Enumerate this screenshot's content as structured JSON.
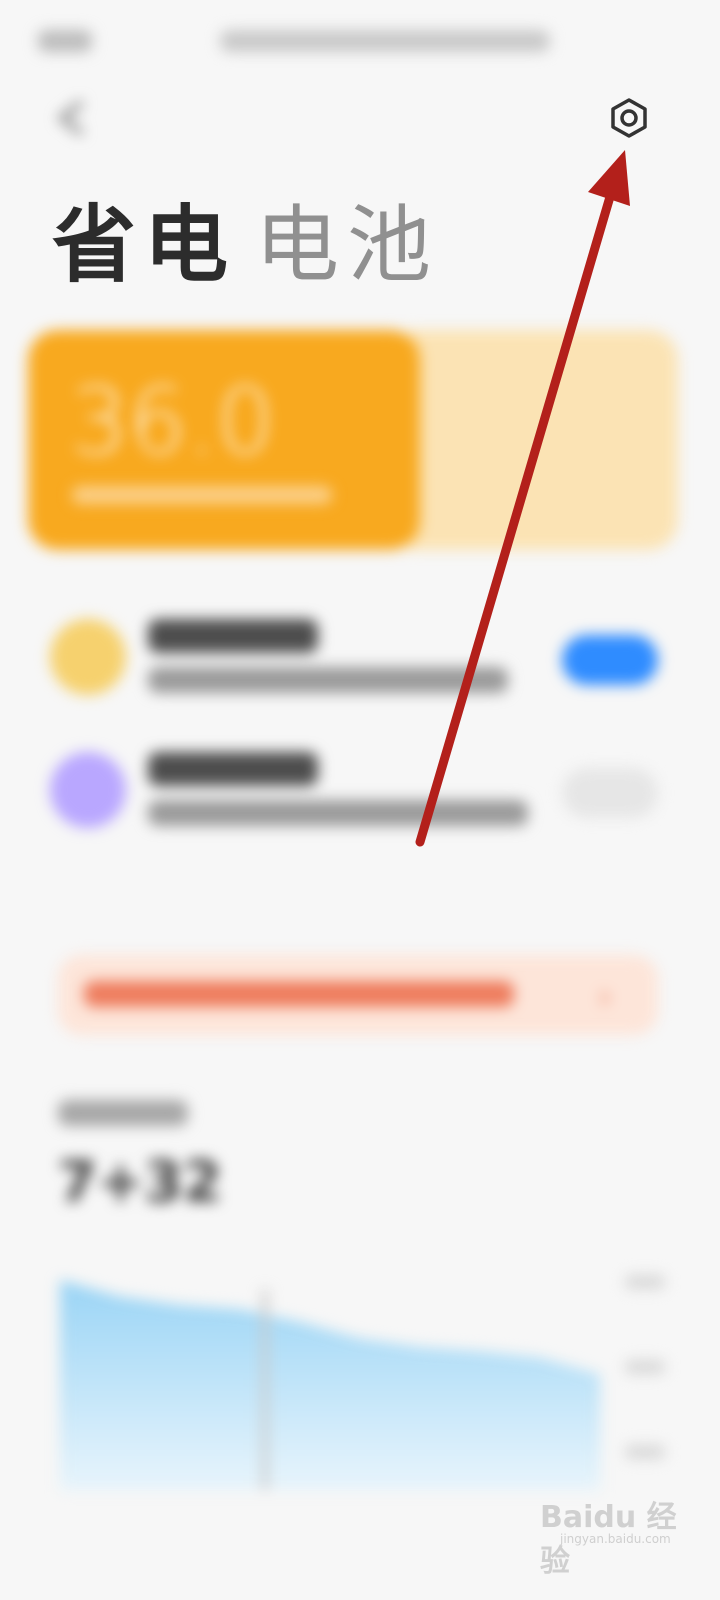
{
  "header": {
    "tabs": [
      {
        "label": "省电",
        "active": true
      },
      {
        "label": "电池",
        "active": false
      }
    ],
    "settings_icon": "gear-icon",
    "back_icon": "back-icon"
  },
  "battery_card": {
    "value": "36.0",
    "accent": "#f8a91f",
    "secondary": "#fbe3b4"
  },
  "modes": [
    {
      "icon_color": "#f6d16e",
      "toggle_on": true,
      "toggle_color": "#2f8cff"
    },
    {
      "icon_color": "#b9a7ff",
      "toggle_on": false,
      "toggle_color": "#e6e6e6"
    }
  ],
  "banner": {
    "chevron": "›",
    "color": "#ee7c5d"
  },
  "usage": {
    "value": "7+32"
  },
  "chart_data": {
    "type": "area",
    "series": [
      {
        "values": [
          100,
          92,
          88,
          86,
          80,
          72,
          68,
          66,
          63,
          55
        ]
      }
    ],
    "fill": "#a9d9f3"
  },
  "annotation": {
    "color": "#b3201b"
  },
  "watermark": {
    "text": "Baidu 经验",
    "subtext": "jingyan.baidu.com"
  }
}
